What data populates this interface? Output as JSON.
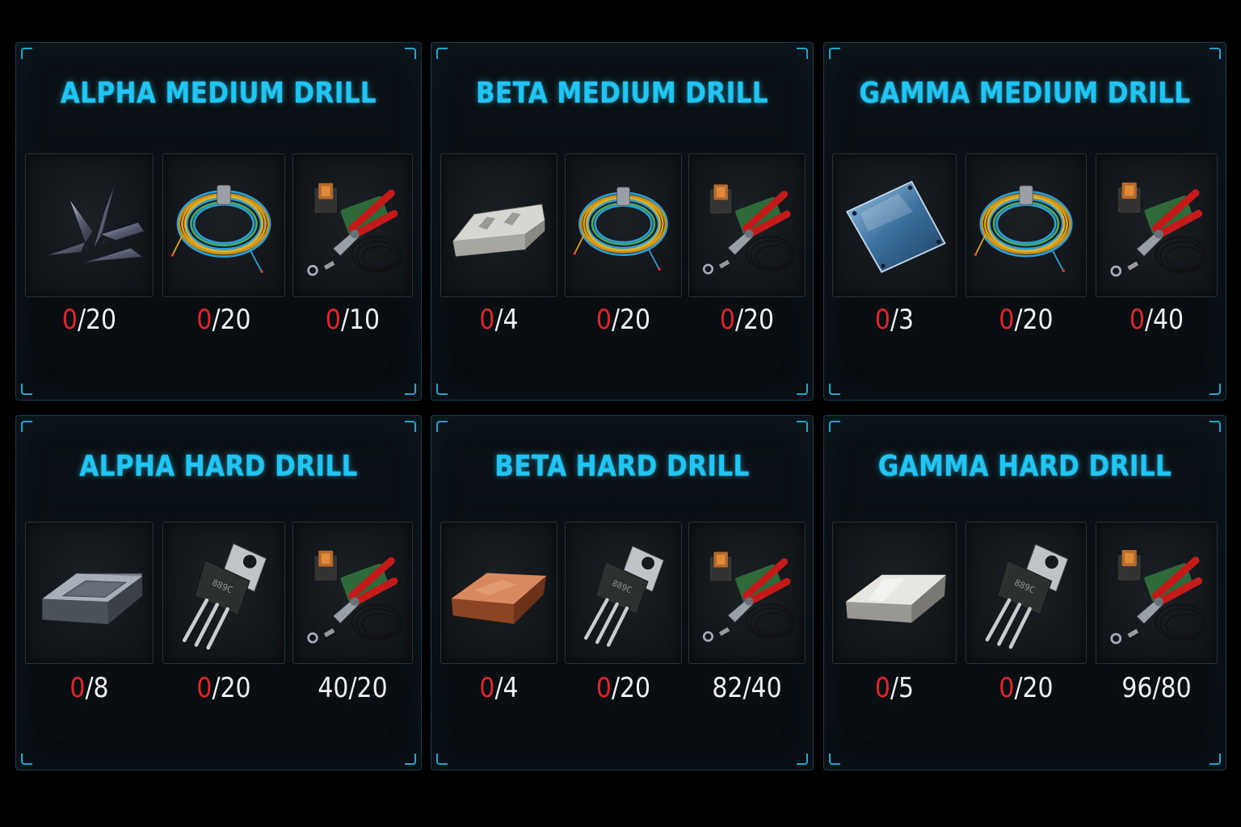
{
  "colors": {
    "title": "#22c4f2",
    "lacking": "#e0262b",
    "count": "#f0f0f0",
    "frame": "#1fa6cf"
  },
  "cards": [
    {
      "title": "ALPHA MEDIUM DRILL",
      "items": [
        {
          "icon": "metal-shards-icon",
          "have": "0",
          "need": "/20",
          "enough": false
        },
        {
          "icon": "wire-coil-icon",
          "have": "0",
          "need": "/20",
          "enough": false
        },
        {
          "icon": "tool-kit-icon",
          "have": "0",
          "need": "/10",
          "enough": false
        }
      ]
    },
    {
      "title": "BETA MEDIUM DRILL",
      "items": [
        {
          "icon": "metal-bar-icon",
          "have": "0",
          "need": "/4",
          "enough": false
        },
        {
          "icon": "wire-coil-icon",
          "have": "0",
          "need": "/20",
          "enough": false
        },
        {
          "icon": "tool-kit-icon",
          "have": "0",
          "need": "/20",
          "enough": false
        }
      ]
    },
    {
      "title": "GAMMA MEDIUM DRILL",
      "items": [
        {
          "icon": "glass-plate-icon",
          "have": "0",
          "need": "/3",
          "enough": false
        },
        {
          "icon": "wire-coil-icon",
          "have": "0",
          "need": "/20",
          "enough": false
        },
        {
          "icon": "tool-kit-icon",
          "have": "0",
          "need": "/40",
          "enough": false
        }
      ]
    },
    {
      "title": "ALPHA HARD DRILL",
      "items": [
        {
          "icon": "steel-ingot-icon",
          "have": "0",
          "need": "/8",
          "enough": false
        },
        {
          "icon": "transistor-icon",
          "have": "0",
          "need": "/20",
          "enough": false
        },
        {
          "icon": "tool-kit-icon",
          "have": "40",
          "need": "/20",
          "enough": true
        }
      ]
    },
    {
      "title": "BETA HARD DRILL",
      "items": [
        {
          "icon": "copper-ingot-icon",
          "have": "0",
          "need": "/4",
          "enough": false
        },
        {
          "icon": "transistor-icon",
          "have": "0",
          "need": "/20",
          "enough": false
        },
        {
          "icon": "tool-kit-icon",
          "have": "82",
          "need": "/40",
          "enough": true
        }
      ]
    },
    {
      "title": "GAMMA HARD DRILL",
      "items": [
        {
          "icon": "silver-ingot-icon",
          "have": "0",
          "need": "/5",
          "enough": false
        },
        {
          "icon": "transistor-icon",
          "have": "0",
          "need": "/20",
          "enough": false
        },
        {
          "icon": "tool-kit-icon",
          "have": "96",
          "need": "/80",
          "enough": true
        }
      ]
    }
  ]
}
